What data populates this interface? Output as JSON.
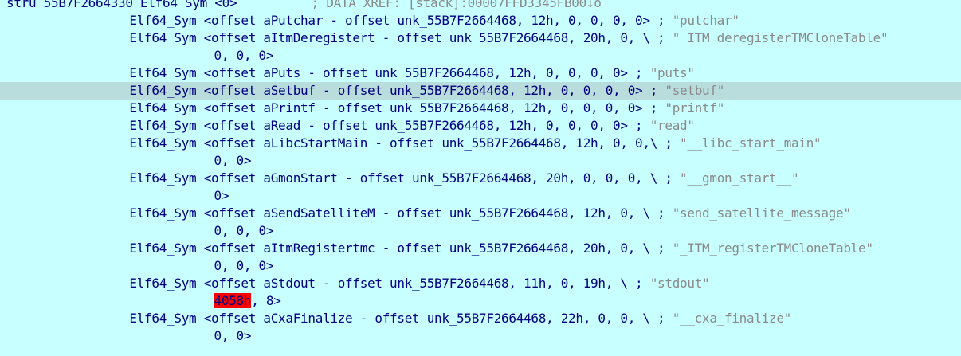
{
  "colors": {
    "background": "#c8ffff",
    "highlight_row": "#b9dcdc",
    "error_bg": "#ff0000"
  },
  "lines": [
    {
      "indent": 0,
      "tokens": [
        {
          "t": "stru_55B7F2664330 Elf64_Sym <0>",
          "c": "navy"
        },
        {
          "t": "          ; DATA XREF: [stack]:00007FFD3345FB00↓o",
          "c": "gray"
        }
      ]
    },
    {
      "indent": 16,
      "tokens": [
        {
          "t": "Elf64_Sym <offset aPutchar - offset unk_55B7F2664468, 12h, 0, 0, 0, 0> ; ",
          "c": "navy"
        },
        {
          "t": "\"putchar\"",
          "c": "gray"
        }
      ]
    },
    {
      "indent": 16,
      "tokens": [
        {
          "t": "Elf64_Sym <offset aItmDeregistert - offset unk_55B7F2664468, 20h, 0, \\ ; ",
          "c": "navy"
        },
        {
          "t": "\"_ITM_deregisterTMCloneTable\"",
          "c": "gray"
        }
      ]
    },
    {
      "indent": 27,
      "tokens": [
        {
          "t": "0, 0, 0>",
          "c": "navy"
        }
      ]
    },
    {
      "indent": 16,
      "tokens": [
        {
          "t": "Elf64_Sym <offset aPuts - offset unk_55B7F2664468, 12h, 0, 0, 0, 0> ; ",
          "c": "navy"
        },
        {
          "t": "\"puts\"",
          "c": "gray"
        }
      ]
    },
    {
      "indent": 16,
      "highlight": true,
      "caret_after": 63,
      "tokens": [
        {
          "t": "Elf64_Sym <offset aSetbuf - offset unk_55B7F2664468, 12h, 0, 0, 0, 0> ; ",
          "c": "navy"
        },
        {
          "t": "\"setbuf\"",
          "c": "gray"
        }
      ]
    },
    {
      "indent": 16,
      "tokens": [
        {
          "t": "Elf64_Sym <offset aPrintf - offset unk_55B7F2664468, 12h, 0, 0, 0, 0> ; ",
          "c": "navy"
        },
        {
          "t": "\"printf\"",
          "c": "gray"
        }
      ]
    },
    {
      "indent": 16,
      "tokens": [
        {
          "t": "Elf64_Sym <offset aRead - offset unk_55B7F2664468, 12h, 0, 0, 0, 0> ; ",
          "c": "navy"
        },
        {
          "t": "\"read\"",
          "c": "gray"
        }
      ]
    },
    {
      "indent": 16,
      "tokens": [
        {
          "t": "Elf64_Sym <offset aLibcStartMain - offset unk_55B7F2664468, 12h, 0, 0,\\ ; ",
          "c": "navy"
        },
        {
          "t": "\"__libc_start_main\"",
          "c": "gray"
        }
      ]
    },
    {
      "indent": 27,
      "tokens": [
        {
          "t": "0, 0>",
          "c": "navy"
        }
      ]
    },
    {
      "indent": 16,
      "tokens": [
        {
          "t": "Elf64_Sym <offset aGmonStart - offset unk_55B7F2664468, 20h, 0, 0, 0, \\ ; ",
          "c": "navy"
        },
        {
          "t": "\"__gmon_start__\"",
          "c": "gray"
        }
      ]
    },
    {
      "indent": 27,
      "tokens": [
        {
          "t": "0>",
          "c": "navy"
        }
      ]
    },
    {
      "indent": 16,
      "tokens": [
        {
          "t": "Elf64_Sym <offset aSendSatelliteM - offset unk_55B7F2664468, 12h, 0, \\ ; ",
          "c": "navy"
        },
        {
          "t": "\"send_satellite_message\"",
          "c": "gray"
        }
      ]
    },
    {
      "indent": 27,
      "tokens": [
        {
          "t": "0, 0, 0>",
          "c": "navy"
        }
      ]
    },
    {
      "indent": 16,
      "tokens": [
        {
          "t": "Elf64_Sym <offset aItmRegistertmc - offset unk_55B7F2664468, 20h, 0, \\ ; ",
          "c": "navy"
        },
        {
          "t": "\"_ITM_registerTMCloneTable\"",
          "c": "gray"
        }
      ]
    },
    {
      "indent": 27,
      "tokens": [
        {
          "t": "0, 0, 0>",
          "c": "navy"
        }
      ]
    },
    {
      "indent": 16,
      "tokens": [
        {
          "t": "Elf64_Sym <offset aStdout - offset unk_55B7F2664468, 11h, 0, 19h, \\ ; ",
          "c": "navy"
        },
        {
          "t": "\"stdout\"",
          "c": "gray"
        }
      ]
    },
    {
      "indent": 27,
      "tokens": [
        {
          "t": "4058h",
          "c": "err"
        },
        {
          "t": ", 8>",
          "c": "navy"
        }
      ]
    },
    {
      "indent": 16,
      "tokens": [
        {
          "t": "Elf64_Sym <offset aCxaFinalize - offset unk_55B7F2664468, 22h, 0, 0, \\ ; ",
          "c": "navy"
        },
        {
          "t": "\"__cxa_finalize\"",
          "c": "gray"
        }
      ]
    },
    {
      "indent": 27,
      "tokens": [
        {
          "t": "0, 0>",
          "c": "navy"
        }
      ]
    }
  ]
}
